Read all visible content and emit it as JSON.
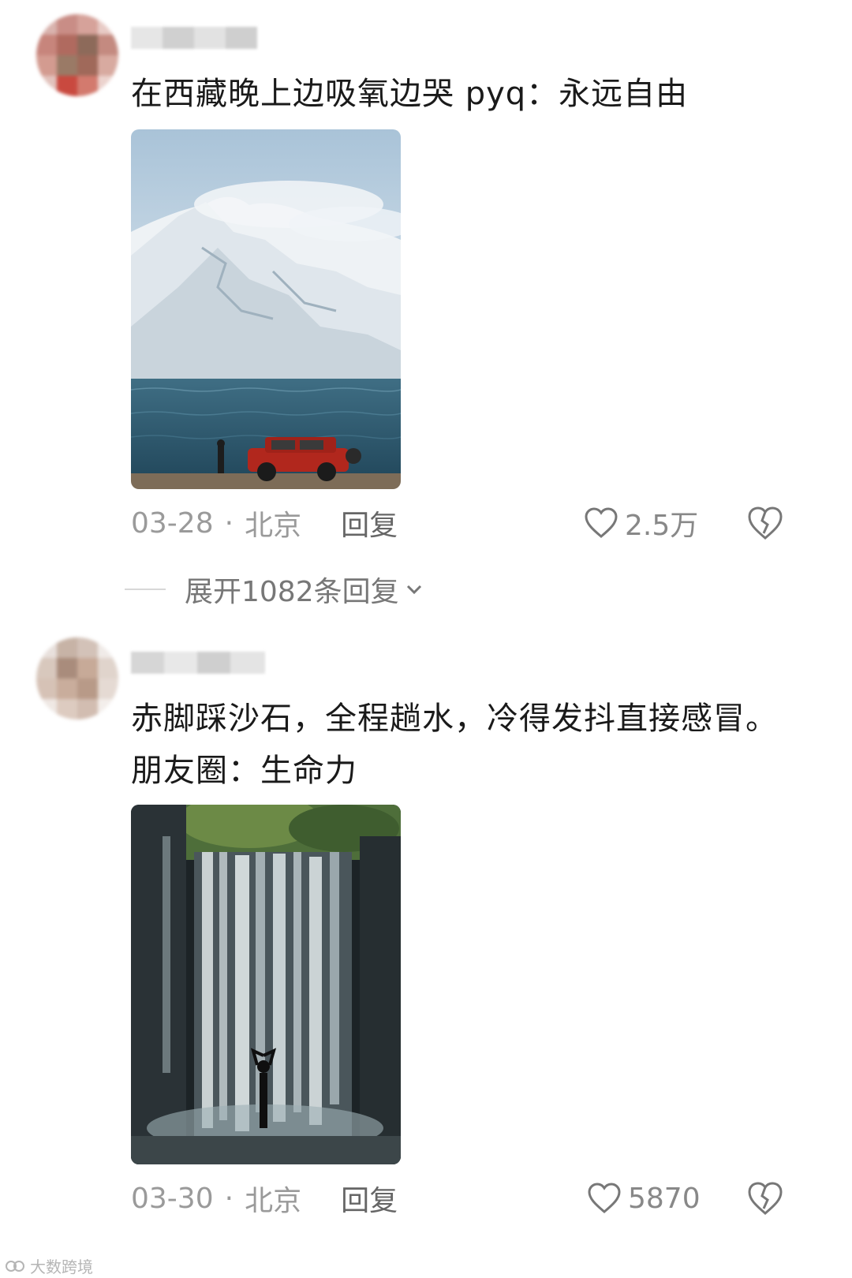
{
  "comments": [
    {
      "text": "在西藏晚上边吸氧边哭  pyq：永远自由",
      "date": "03-28",
      "location": "北京",
      "reply_label": "回复",
      "likes": "2.5万",
      "image_desc_icon": "photo-icon"
    },
    {
      "text": "赤脚踩沙石，全程趟水，冷得发抖直接感冒。朋友圈：生命力",
      "date": "03-30",
      "location": "北京",
      "reply_label": "回复",
      "likes": "5870",
      "image_desc_icon": "photo-icon"
    }
  ],
  "expand_replies": "展开1082条回复",
  "separator": "·",
  "watermark": "大数跨境",
  "colors": {
    "text": "#1a1a1a",
    "meta": "#9a9a9a",
    "icon": "#888888"
  }
}
